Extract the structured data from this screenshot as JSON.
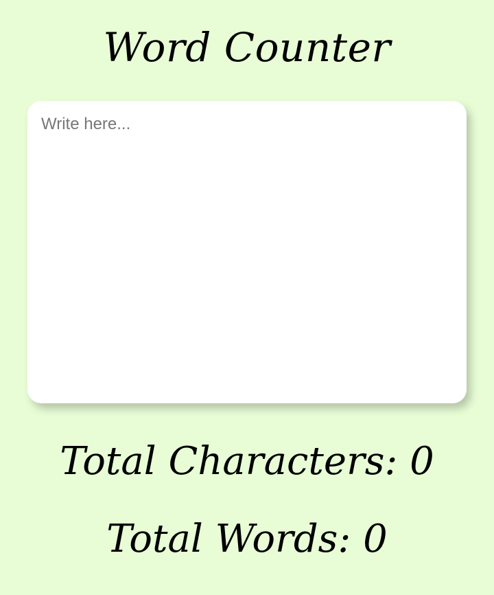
{
  "app": {
    "title": "Word Counter"
  },
  "editor": {
    "value": "",
    "placeholder": "Write here..."
  },
  "stats": {
    "characters_label": "Total Characters: ",
    "characters_value": "0",
    "words_label": "Total Words: ",
    "words_value": "0"
  },
  "colors": {
    "background": "#e8fdd6",
    "card": "#ffffff",
    "text": "#000000",
    "placeholder": "#777777"
  }
}
